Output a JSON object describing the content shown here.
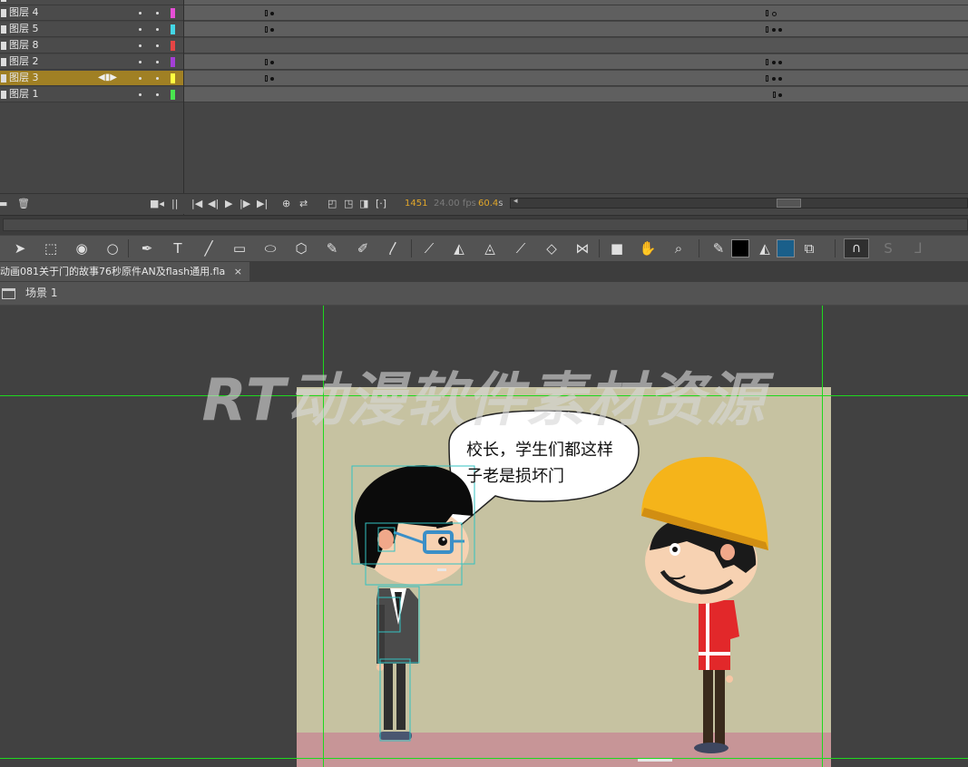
{
  "timeline": {
    "layers": [
      {
        "name": "图层 4",
        "color": "#e64fd6",
        "selected": false
      },
      {
        "name": "图层 5",
        "color": "#44d6e6",
        "selected": false
      },
      {
        "name": "图层 8",
        "color": "#e64545",
        "selected": false
      },
      {
        "name": "图层 2",
        "color": "#a43fd6",
        "selected": false
      },
      {
        "name": "图层 3",
        "color": "#ffff40",
        "selected": true
      },
      {
        "name": "图层 1",
        "color": "#49e64f",
        "selected": false
      }
    ],
    "current_frame": "1451",
    "fps": "24.00 fps",
    "time": "60.4",
    "time_unit": "s"
  },
  "document": {
    "tab_title": "动画081关于门的故事76秒原件AN及flash通用.fla",
    "close_label": "×",
    "scene_label": "场景 1"
  },
  "tools": [
    "selection-tool",
    "free-transform-tool",
    "3d-rotation-tool",
    "lasso-tool",
    "pen-tool",
    "text-tool",
    "line-tool",
    "rectangle-tool",
    "oval-tool",
    "polystar-tool",
    "pencil-tool",
    "paint-brush-tool",
    "brush-tool",
    "bone-tool",
    "paint-bucket-tool",
    "ink-bottle-tool",
    "eyedropper-tool",
    "eraser-tool",
    "width-tool",
    "camera-tool",
    "hand-tool",
    "zoom-tool"
  ],
  "colors": {
    "stroke": "#000000",
    "fill": "#1a5f8a",
    "stage": "#c6c2a1",
    "floor": "#c79597",
    "guide": "#1ed81e"
  },
  "stage": {
    "watermark": "RT动漫软件素材资源",
    "speech": [
      "校长，学生们都这样",
      "子老是损坏门"
    ]
  }
}
